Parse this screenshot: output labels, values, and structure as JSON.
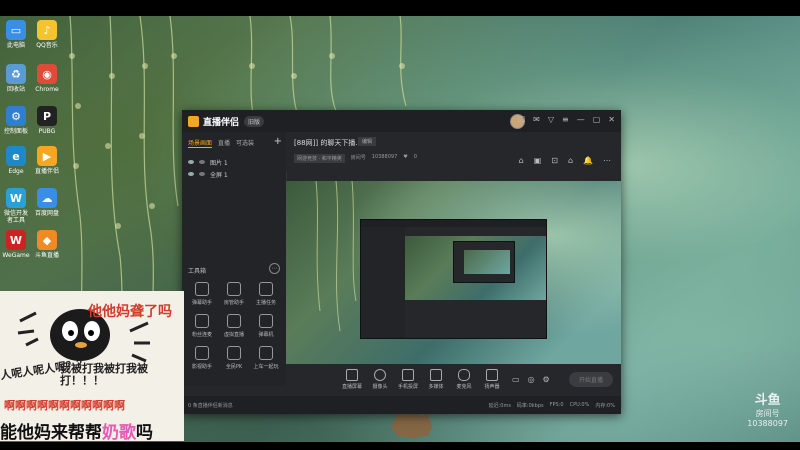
{
  "desktop": {
    "icons": [
      {
        "label": "此电脑",
        "color": "#3a8ee6",
        "glyph": "▭"
      },
      {
        "label": "QQ音乐",
        "color": "#f4c430",
        "glyph": "♪"
      },
      {
        "label": "回收站",
        "color": "#5b9bd5",
        "glyph": "♻"
      },
      {
        "label": "Chrome",
        "color": "#dd4b39",
        "glyph": "◉"
      },
      {
        "label": "控制面板",
        "color": "#2f7fd1",
        "glyph": "⚙"
      },
      {
        "label": "PUBG",
        "color": "#222222",
        "glyph": "P"
      },
      {
        "label": "Edge",
        "color": "#1e88c8",
        "glyph": "e"
      },
      {
        "label": "直播伴侣",
        "color": "#f5a623",
        "glyph": "▶"
      },
      {
        "label": "微信开发者工具",
        "color": "#2aa0d8",
        "glyph": "W"
      },
      {
        "label": "百度网盘",
        "color": "#3a8ee6",
        "glyph": "☁"
      },
      {
        "label": "WeGame",
        "color": "#cc2222",
        "glyph": "W"
      },
      {
        "label": "斗鱼直播",
        "color": "#f08a24",
        "glyph": "◆"
      }
    ]
  },
  "window": {
    "app_name": "直播伴侣",
    "version_badge": "旧版",
    "controls": [
      "☐",
      "✉",
      "▽",
      "≡",
      "—",
      "▢",
      "✕"
    ],
    "tabs": [
      "场景画面",
      "直播",
      "可选装"
    ],
    "add_label": "+",
    "scenes": [
      {
        "label": "图片 1"
      },
      {
        "label": "全屏 1"
      }
    ],
    "tools_title": "工具箱",
    "tools_more": "⋯",
    "tools": [
      "弹幕助手",
      "房管助手",
      "主播任务",
      "粉丝连麦",
      "虚拟直播",
      "弹幕机",
      "影视助手",
      "全民PK",
      "上车一起玩"
    ],
    "room": {
      "title": "[88网]] 的聊天下播…",
      "tag": "编辑",
      "category": "网游竞技 · 和平精英",
      "room_label": "房间号",
      "room_id": "10388097",
      "likes": "0"
    },
    "header_icons": [
      "⌂",
      "▣",
      "⊡",
      "⌂",
      "🔔",
      "⋯"
    ],
    "bottom_tools": [
      "直播屏幕",
      "摄像头",
      "手机投屏",
      "多媒体",
      "麦克风",
      "扬声器"
    ],
    "side_controls": [
      "▭",
      "◎",
      "⚙"
    ],
    "start_button": "开始直播",
    "status_left": "0 条直播伴侣新消息",
    "status_right": [
      "延迟:0ms",
      "码率:0kbps",
      "FPS:0",
      "CPU:0%",
      "内存:0%"
    ]
  },
  "overlay": {
    "line1": "他他妈聋了吗",
    "line2": "人呢人呢人呢？？",
    "line3": "我被打我被打我被打！！！",
    "line4": "啊啊啊啊啊啊啊啊啊啊啊",
    "line5a": "能他妈来帮帮",
    "line5b": "奶歌",
    "line5c": "吗"
  },
  "watermark": {
    "brand": "斗鱼",
    "room_label": "房间号",
    "room_id": "10388097"
  },
  "colors": {
    "accent": "#f5a623",
    "meme_red": "#d43a2a",
    "window_bg": "#26272b"
  }
}
